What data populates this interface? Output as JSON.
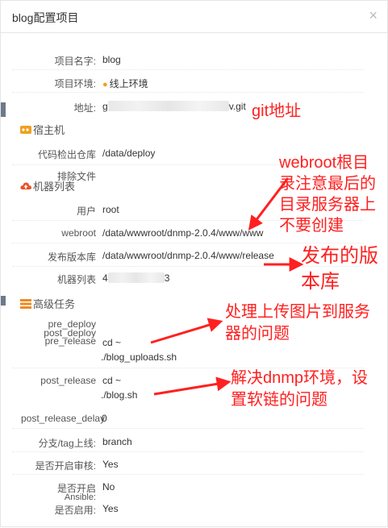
{
  "dialog": {
    "title": "blog配置项目",
    "close": "×"
  },
  "fields": {
    "project_name": {
      "label": "项目名字:",
      "value": "blog"
    },
    "project_env": {
      "label": "项目环境:",
      "value": "线上环境"
    },
    "address": {
      "label": "地址:",
      "value_prefix": "g",
      "value_suffix": "v.git"
    }
  },
  "sections": {
    "host": "宿主机",
    "machines": "机器列表",
    "advanced": "高级任务"
  },
  "host_fields": {
    "checkout_repo": {
      "label": "代码检出仓库",
      "value": "/data/deploy"
    },
    "exclude_files": {
      "label": "排除文件",
      "value": ""
    }
  },
  "machine_fields": {
    "user": {
      "label": "用户",
      "value": "root"
    },
    "webroot": {
      "label": "webroot",
      "value": "/data/wwwroot/dnmp-2.0.4/www/www"
    },
    "release_repo": {
      "label": "发布版本库",
      "value": "/data/wwwroot/dnmp-2.0.4/www/release"
    },
    "machine_list": {
      "label": "机器列表",
      "value_prefix": "4",
      "value_suffix": "3"
    }
  },
  "task_fields": {
    "pre_deploy": {
      "label": "pre_deploy",
      "value": ""
    },
    "post_deploy": {
      "label": "post_deploy",
      "value": ""
    },
    "pre_release": {
      "label": "pre_release",
      "line1": "cd ~",
      "line2": "./blog_uploads.sh"
    },
    "post_release": {
      "label": "post_release",
      "line1": "cd ~",
      "line2": "./blog.sh"
    },
    "post_release_delay": {
      "label": "post_release_delay",
      "value": "0"
    }
  },
  "option_fields": {
    "branch_tag": {
      "label": "分支/tag上线:",
      "value": "branch"
    },
    "audit": {
      "label": "是否开启审核:",
      "value": "Yes"
    },
    "ansible": {
      "label": "是否开启 Ansible:",
      "label_line1": "是否开启",
      "label_line2": "Ansible:",
      "value": "No"
    },
    "enabled": {
      "label": "是否启用:",
      "value": "Yes"
    }
  },
  "annotations": {
    "git": "git地址",
    "webroot_1": "webroot根目",
    "webroot_2": "录注意最后的",
    "webroot_3": "目录服务器上",
    "webroot_4": "不要创建",
    "release_1": "发布的版",
    "release_2": "本库",
    "upload_1": "处理上传图片到服务",
    "upload_2": "器的问题",
    "dnmp_1": "解决dnmp环境，设",
    "dnmp_2": "置软链的问题"
  },
  "icons": {
    "host": "server-icon",
    "machines": "cloud-upload-icon",
    "advanced": "tasks-icon",
    "env": "map-pin-icon",
    "close": "close-icon"
  },
  "colors": {
    "annotation": "#ff2020",
    "host_icon": "#f0a020",
    "machines_icon": "#e8542a",
    "advanced_icon": "#f08a20"
  }
}
